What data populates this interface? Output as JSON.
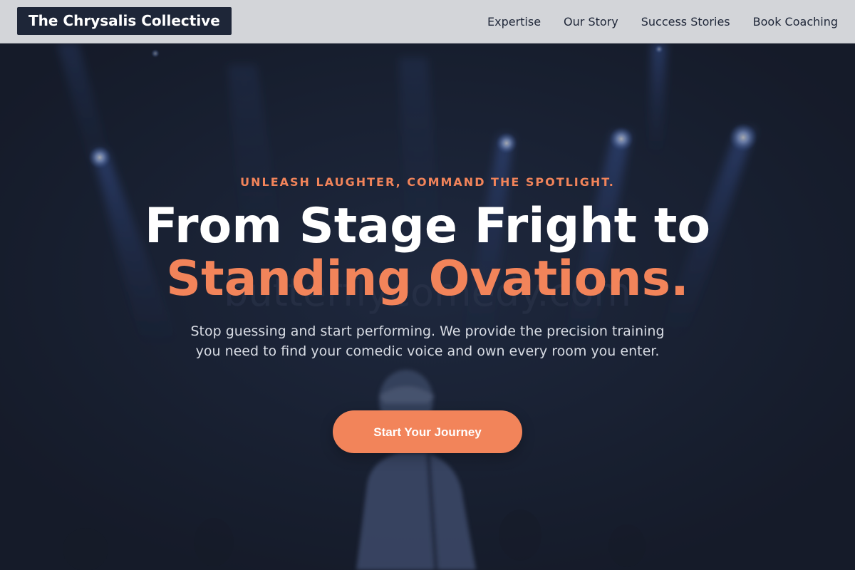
{
  "header": {
    "logo": "The Chrysalis Collective",
    "nav": [
      {
        "label": "Expertise"
      },
      {
        "label": "Our Story"
      },
      {
        "label": "Success Stories"
      },
      {
        "label": "Book Coaching"
      }
    ]
  },
  "hero": {
    "eyebrow": "UNLEASH LAUGHTER, COMMAND THE SPOTLIGHT.",
    "headline_line1": "From Stage Fright to",
    "headline_line2": "Standing Ovations.",
    "subtext": "Stop guessing and start performing. We provide the precision training you need to find your comedic voice and own every room you enter.",
    "cta_label": "Start Your Journey",
    "background_watermark": "butterflycomedy.com"
  },
  "colors": {
    "accent": "#f2845a",
    "navy": "#1e2638",
    "header_bg": "#d3d5d9",
    "hero_bg": "#1b2232"
  }
}
